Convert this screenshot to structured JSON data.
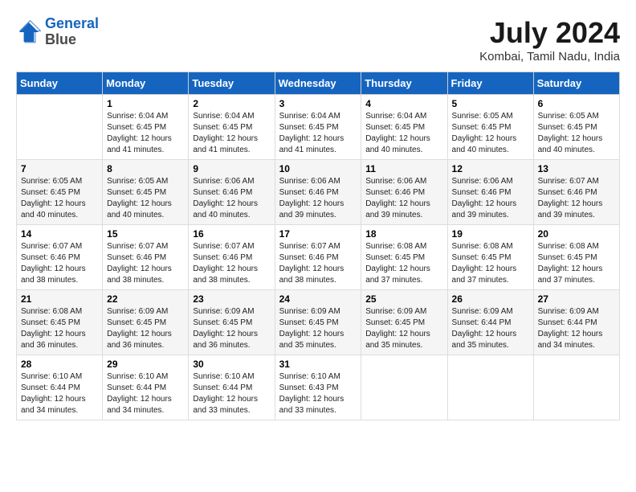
{
  "header": {
    "logo_line1": "General",
    "logo_line2": "Blue",
    "month_title": "July 2024",
    "location": "Kombai, Tamil Nadu, India"
  },
  "weekdays": [
    "Sunday",
    "Monday",
    "Tuesday",
    "Wednesday",
    "Thursday",
    "Friday",
    "Saturday"
  ],
  "weeks": [
    [
      {
        "day": "",
        "sunrise": "",
        "sunset": "",
        "daylight": ""
      },
      {
        "day": "1",
        "sunrise": "Sunrise: 6:04 AM",
        "sunset": "Sunset: 6:45 PM",
        "daylight": "Daylight: 12 hours and 41 minutes."
      },
      {
        "day": "2",
        "sunrise": "Sunrise: 6:04 AM",
        "sunset": "Sunset: 6:45 PM",
        "daylight": "Daylight: 12 hours and 41 minutes."
      },
      {
        "day": "3",
        "sunrise": "Sunrise: 6:04 AM",
        "sunset": "Sunset: 6:45 PM",
        "daylight": "Daylight: 12 hours and 41 minutes."
      },
      {
        "day": "4",
        "sunrise": "Sunrise: 6:04 AM",
        "sunset": "Sunset: 6:45 PM",
        "daylight": "Daylight: 12 hours and 40 minutes."
      },
      {
        "day": "5",
        "sunrise": "Sunrise: 6:05 AM",
        "sunset": "Sunset: 6:45 PM",
        "daylight": "Daylight: 12 hours and 40 minutes."
      },
      {
        "day": "6",
        "sunrise": "Sunrise: 6:05 AM",
        "sunset": "Sunset: 6:45 PM",
        "daylight": "Daylight: 12 hours and 40 minutes."
      }
    ],
    [
      {
        "day": "7",
        "sunrise": "Sunrise: 6:05 AM",
        "sunset": "Sunset: 6:45 PM",
        "daylight": "Daylight: 12 hours and 40 minutes."
      },
      {
        "day": "8",
        "sunrise": "Sunrise: 6:05 AM",
        "sunset": "Sunset: 6:45 PM",
        "daylight": "Daylight: 12 hours and 40 minutes."
      },
      {
        "day": "9",
        "sunrise": "Sunrise: 6:06 AM",
        "sunset": "Sunset: 6:46 PM",
        "daylight": "Daylight: 12 hours and 40 minutes."
      },
      {
        "day": "10",
        "sunrise": "Sunrise: 6:06 AM",
        "sunset": "Sunset: 6:46 PM",
        "daylight": "Daylight: 12 hours and 39 minutes."
      },
      {
        "day": "11",
        "sunrise": "Sunrise: 6:06 AM",
        "sunset": "Sunset: 6:46 PM",
        "daylight": "Daylight: 12 hours and 39 minutes."
      },
      {
        "day": "12",
        "sunrise": "Sunrise: 6:06 AM",
        "sunset": "Sunset: 6:46 PM",
        "daylight": "Daylight: 12 hours and 39 minutes."
      },
      {
        "day": "13",
        "sunrise": "Sunrise: 6:07 AM",
        "sunset": "Sunset: 6:46 PM",
        "daylight": "Daylight: 12 hours and 39 minutes."
      }
    ],
    [
      {
        "day": "14",
        "sunrise": "Sunrise: 6:07 AM",
        "sunset": "Sunset: 6:46 PM",
        "daylight": "Daylight: 12 hours and 38 minutes."
      },
      {
        "day": "15",
        "sunrise": "Sunrise: 6:07 AM",
        "sunset": "Sunset: 6:46 PM",
        "daylight": "Daylight: 12 hours and 38 minutes."
      },
      {
        "day": "16",
        "sunrise": "Sunrise: 6:07 AM",
        "sunset": "Sunset: 6:46 PM",
        "daylight": "Daylight: 12 hours and 38 minutes."
      },
      {
        "day": "17",
        "sunrise": "Sunrise: 6:07 AM",
        "sunset": "Sunset: 6:46 PM",
        "daylight": "Daylight: 12 hours and 38 minutes."
      },
      {
        "day": "18",
        "sunrise": "Sunrise: 6:08 AM",
        "sunset": "Sunset: 6:45 PM",
        "daylight": "Daylight: 12 hours and 37 minutes."
      },
      {
        "day": "19",
        "sunrise": "Sunrise: 6:08 AM",
        "sunset": "Sunset: 6:45 PM",
        "daylight": "Daylight: 12 hours and 37 minutes."
      },
      {
        "day": "20",
        "sunrise": "Sunrise: 6:08 AM",
        "sunset": "Sunset: 6:45 PM",
        "daylight": "Daylight: 12 hours and 37 minutes."
      }
    ],
    [
      {
        "day": "21",
        "sunrise": "Sunrise: 6:08 AM",
        "sunset": "Sunset: 6:45 PM",
        "daylight": "Daylight: 12 hours and 36 minutes."
      },
      {
        "day": "22",
        "sunrise": "Sunrise: 6:09 AM",
        "sunset": "Sunset: 6:45 PM",
        "daylight": "Daylight: 12 hours and 36 minutes."
      },
      {
        "day": "23",
        "sunrise": "Sunrise: 6:09 AM",
        "sunset": "Sunset: 6:45 PM",
        "daylight": "Daylight: 12 hours and 36 minutes."
      },
      {
        "day": "24",
        "sunrise": "Sunrise: 6:09 AM",
        "sunset": "Sunset: 6:45 PM",
        "daylight": "Daylight: 12 hours and 35 minutes."
      },
      {
        "day": "25",
        "sunrise": "Sunrise: 6:09 AM",
        "sunset": "Sunset: 6:45 PM",
        "daylight": "Daylight: 12 hours and 35 minutes."
      },
      {
        "day": "26",
        "sunrise": "Sunrise: 6:09 AM",
        "sunset": "Sunset: 6:44 PM",
        "daylight": "Daylight: 12 hours and 35 minutes."
      },
      {
        "day": "27",
        "sunrise": "Sunrise: 6:09 AM",
        "sunset": "Sunset: 6:44 PM",
        "daylight": "Daylight: 12 hours and 34 minutes."
      }
    ],
    [
      {
        "day": "28",
        "sunrise": "Sunrise: 6:10 AM",
        "sunset": "Sunset: 6:44 PM",
        "daylight": "Daylight: 12 hours and 34 minutes."
      },
      {
        "day": "29",
        "sunrise": "Sunrise: 6:10 AM",
        "sunset": "Sunset: 6:44 PM",
        "daylight": "Daylight: 12 hours and 34 minutes."
      },
      {
        "day": "30",
        "sunrise": "Sunrise: 6:10 AM",
        "sunset": "Sunset: 6:44 PM",
        "daylight": "Daylight: 12 hours and 33 minutes."
      },
      {
        "day": "31",
        "sunrise": "Sunrise: 6:10 AM",
        "sunset": "Sunset: 6:43 PM",
        "daylight": "Daylight: 12 hours and 33 minutes."
      },
      {
        "day": "",
        "sunrise": "",
        "sunset": "",
        "daylight": ""
      },
      {
        "day": "",
        "sunrise": "",
        "sunset": "",
        "daylight": ""
      },
      {
        "day": "",
        "sunrise": "",
        "sunset": "",
        "daylight": ""
      }
    ]
  ]
}
